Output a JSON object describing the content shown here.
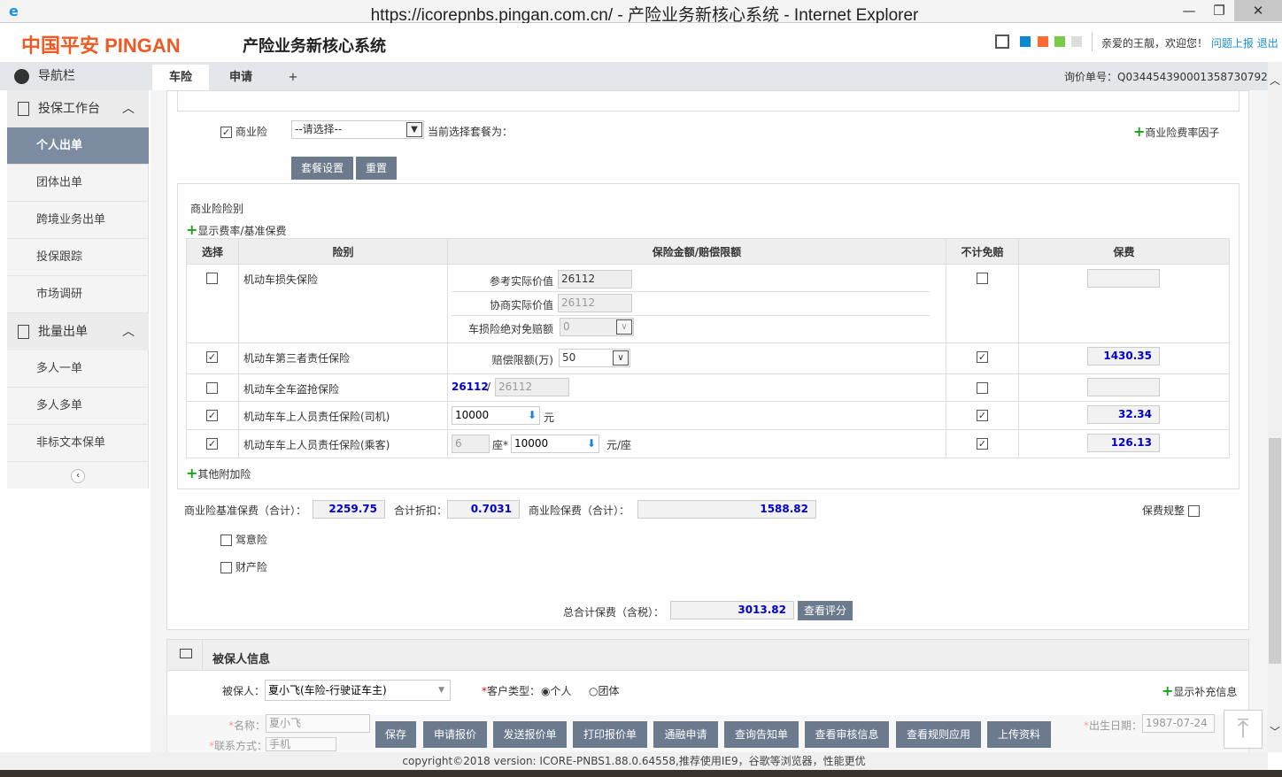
{
  "window": {
    "title": "https://icorepnbs.pingan.com.cn/ - 产险业务新核心系统 - Internet Explorer",
    "min": "—",
    "max": "❐",
    "close": "✕"
  },
  "header": {
    "logo": "中国平安 PINGAN",
    "system_name": "产险业务新核心系统",
    "welcome": "亲爱的王靓，欢迎您！",
    "report_link": "问题上报",
    "logout_link": "退出",
    "theme_colors": [
      "#0a88d0",
      "#ff6a33",
      "#77cc44",
      "#dddddd"
    ]
  },
  "tabs": [
    {
      "label": "车险"
    },
    {
      "label": "申请"
    },
    {
      "label": "+"
    }
  ],
  "inquiry_no": "询价单号：Q034454390001358730792",
  "sidebar": {
    "nav_title": "导航栏",
    "groups": [
      {
        "label": "投保工作台",
        "items": [
          "个人出单",
          "团体出单",
          "跨境业务出单",
          "投保跟踪",
          "市场调研"
        ]
      },
      {
        "label": "批量出单",
        "items": [
          "多人一单",
          "多人多单",
          "非标文本保单"
        ]
      }
    ]
  },
  "commercial": {
    "label": "商业险",
    "package_placeholder": "--请选择--",
    "current_package": "当前选择套餐为：",
    "rate_factor": "商业险费率因子",
    "btn_package": "套餐设置",
    "btn_reset": "重置",
    "section_title": "商业险险别",
    "show_rate": "显示费率/基准保费",
    "other_addon": "其他附加险",
    "columns": [
      "选择",
      "险别",
      "保险金额/赔偿限额",
      "不计免赔",
      "保费"
    ],
    "rows": [
      {
        "name": "机动车损失保险",
        "checked": false,
        "nodeduct": false,
        "fee": "",
        "fields": [
          {
            "label": "参考实际价值",
            "value": "26112"
          },
          {
            "label": "协商实际价值",
            "value": "26112"
          },
          {
            "label": "车损险绝对免赔额",
            "value": "0"
          }
        ]
      },
      {
        "name": "机动车第三者责任保险",
        "checked": true,
        "nodeduct": true,
        "fee": "1430.35",
        "label": "赔偿限额(万)",
        "value": "50"
      },
      {
        "name": "机动车全车盗抢保险",
        "checked": false,
        "nodeduct": false,
        "fee": "",
        "amount": "26112",
        "sep": "/",
        "value": "26112"
      },
      {
        "name": "机动车车上人员责任保险(司机)",
        "checked": true,
        "nodeduct": true,
        "fee": "32.34",
        "value": "10000",
        "unit": "元"
      },
      {
        "name": "机动车车上人员责任保险(乘客)",
        "checked": true,
        "nodeduct": true,
        "fee": "126.13",
        "seats": "6",
        "seat_unit": "座*",
        "value": "10000",
        "unit": "元/座"
      }
    ]
  },
  "summary": {
    "base_label": "商业险基准保费（合计）：",
    "base": "2259.75",
    "discount_label": "合计折扣：",
    "discount": "0.7031",
    "premium_label": "商业险保费（合计）：",
    "premium": "1588.82",
    "adjust_label": "保费规整"
  },
  "other": {
    "accident": "驾意险",
    "property": "财产险",
    "total_label": "总合计保费（含税）：",
    "total": "3013.82",
    "view_score": "查看评分"
  },
  "insured": {
    "title": "被保人信息",
    "insured_label": "被保人：",
    "insured_value": "夏小飞(车险-行驶证车主)",
    "cust_type_label": "客户类型：",
    "personal": "个人",
    "group": "团体",
    "show_more": "显示补充信息",
    "name_label": "名称：",
    "name_value": "夏小飞",
    "birth_label": "出生日期：",
    "birth_value": "1987-07-24",
    "contact_label": "联系方式：",
    "contact_value": "手机"
  },
  "actions": [
    "保存",
    "申请报价",
    "发送报价单",
    "打印报价单",
    "通融申请",
    "查询告知单",
    "查看审核信息",
    "查看规则应用",
    "上传资料"
  ],
  "footer": "copyright©2018 version: ICORE-PNBS1.88.0.64558,推荐使用IE9，谷歌等浏览器，性能更优"
}
